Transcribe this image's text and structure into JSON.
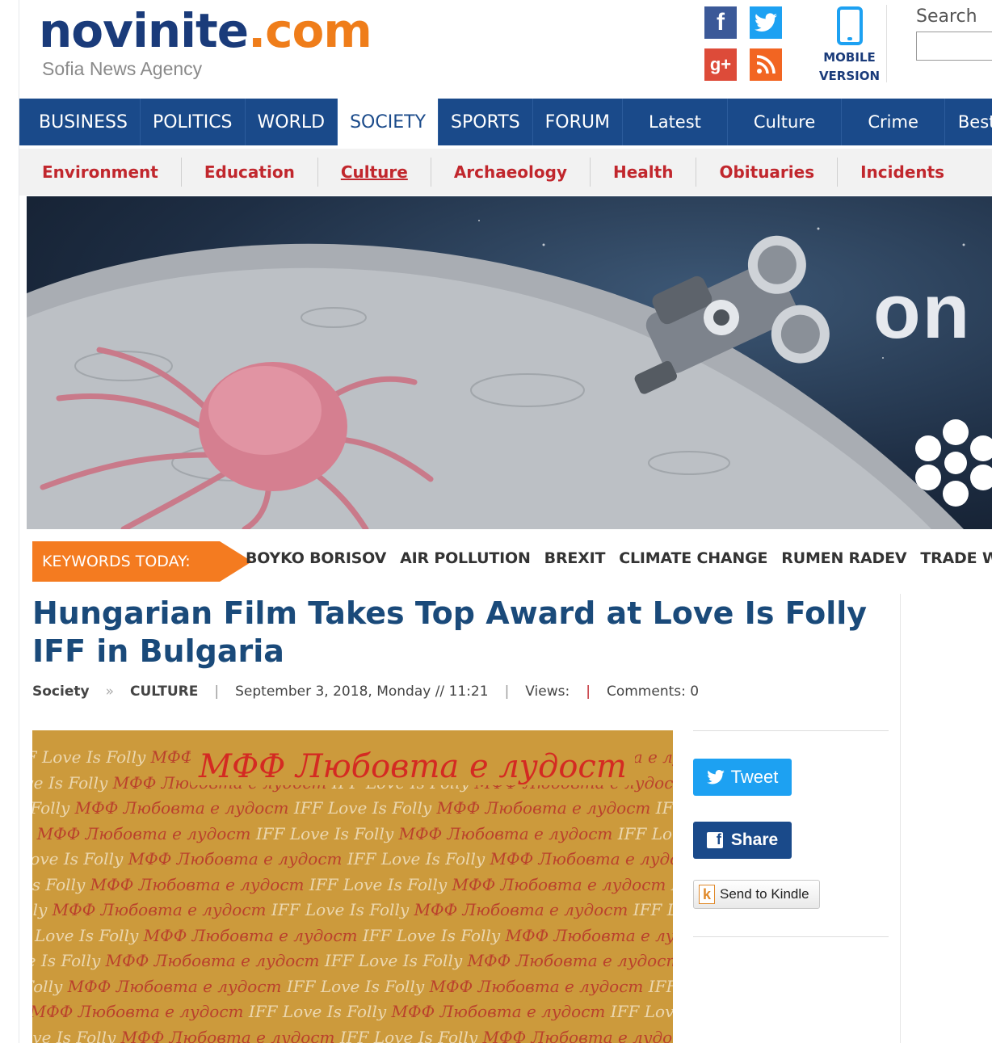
{
  "logo": {
    "main_prefix": "novinite",
    "main_suffix": ".com",
    "tagline": "Sofia News Agency"
  },
  "social": [
    "facebook-icon",
    "twitter-icon",
    "google-plus-icon",
    "rss-icon"
  ],
  "mobile": {
    "line1": "MOBILE",
    "line2": "VERSION"
  },
  "search": {
    "label": "Search",
    "value": ""
  },
  "main_nav": {
    "items": [
      "BUSINESS",
      "POLITICS",
      "WORLD",
      "SOCIETY",
      "SPORTS",
      "FORUM",
      "Latest",
      "Culture",
      "Crime",
      "Best in Bulgaria"
    ],
    "active": "SOCIETY"
  },
  "sub_nav": {
    "items": [
      "Environment",
      "Education",
      "Culture",
      "Archaeology",
      "Health",
      "Obituaries",
      "Incidents"
    ],
    "current": "Culture"
  },
  "banner": {
    "brand_text": "on"
  },
  "keywords": {
    "label": "KEYWORDS TODAY:",
    "items": [
      "BOYKO BORISOV",
      "AIR POLLUTION",
      "BREXIT",
      "CLIMATE CHANGE",
      "RUMEN RADEV",
      "TRADE WAR"
    ]
  },
  "article": {
    "title": "Hungarian Film Takes Top Award at Love Is Folly IFF in Bulgaria",
    "section": "Society",
    "breadcrumb_sep": "»",
    "category": "CULTURE",
    "date": "September 3, 2018, Monday // 11:21",
    "views_label": "Views:",
    "comments": "Comments: 0"
  },
  "photo": {
    "headline": "МФФ Любовта е лудост",
    "pattern_a": "IFF Love Is Folly",
    "pattern_b": "МФФ Любовта е лудост"
  },
  "share": {
    "tweet": "Tweet",
    "share": "Share",
    "kindle": "Send to Kindle"
  },
  "colors": {
    "brand_blue": "#1a4a8a",
    "accent_orange": "#f47b20",
    "subnav_red": "#c1272d",
    "twitter": "#1da1f2"
  }
}
